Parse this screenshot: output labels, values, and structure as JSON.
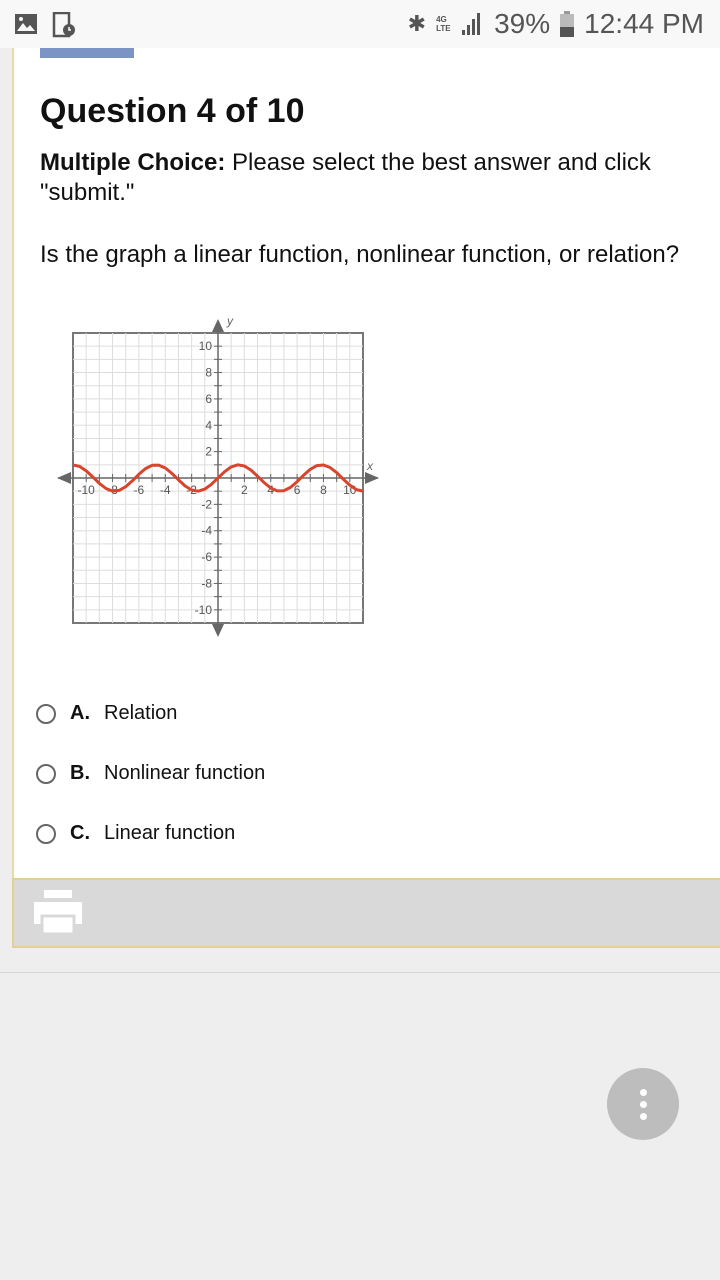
{
  "status_bar": {
    "network": "4G LTE",
    "battery": "39%",
    "time": "12:44 PM"
  },
  "question": {
    "title": "Question 4 of 10",
    "instruction_bold": "Multiple Choice:",
    "instruction_text": " Please select the best answer and click \"submit.\"",
    "prompt": "Is the graph a linear function, nonlinear function, or relation?"
  },
  "options": [
    {
      "letter": "A.",
      "label": "Relation"
    },
    {
      "letter": "B.",
      "label": "Nonlinear function"
    },
    {
      "letter": "C.",
      "label": "Linear function"
    }
  ],
  "chart_data": {
    "type": "line",
    "xlabel": "x",
    "ylabel": "y",
    "xlim": [
      -11,
      11
    ],
    "ylim": [
      -11,
      11
    ],
    "grid": true,
    "x_ticks": [
      "-10",
      "-8",
      "-6",
      "-4",
      "-2",
      "2",
      "4",
      "6",
      "8",
      "10"
    ],
    "y_ticks": [
      "10",
      "8",
      "6",
      "4",
      "2",
      "-2",
      "-4",
      "-6",
      "-8",
      "-10"
    ],
    "line_color": "#d9442c",
    "x": [
      -11,
      -10.5,
      -10,
      -9.5,
      -9,
      -8.5,
      -8,
      -7.5,
      -7,
      -6.5,
      -6,
      -5.5,
      -5,
      -4.5,
      -4,
      -3.5,
      -3,
      -2.5,
      -2,
      -1.5,
      -1,
      -0.5,
      0,
      0.5,
      1,
      1.5,
      2,
      2.5,
      3,
      3.5,
      4,
      4.5,
      5,
      5.5,
      6,
      6.5,
      7,
      7.5,
      8,
      8.5,
      9,
      9.5,
      10,
      10.5,
      11
    ],
    "y": [
      0.99,
      0.88,
      0.54,
      0.08,
      -0.41,
      -0.8,
      -0.99,
      -0.94,
      -0.66,
      -0.22,
      0.28,
      0.71,
      0.96,
      0.98,
      0.76,
      0.35,
      -0.14,
      -0.6,
      -0.91,
      -1.0,
      -0.84,
      -0.48,
      0,
      0.48,
      0.84,
      1.0,
      0.91,
      0.6,
      0.14,
      -0.35,
      -0.76,
      -0.98,
      -0.96,
      -0.71,
      -0.28,
      0.22,
      0.66,
      0.94,
      0.99,
      0.8,
      0.41,
      -0.08,
      -0.54,
      -0.88,
      -0.99
    ]
  },
  "toolbar": {
    "print_icon": "printer-icon"
  },
  "fab": {
    "icon": "more-vertical-icon"
  }
}
